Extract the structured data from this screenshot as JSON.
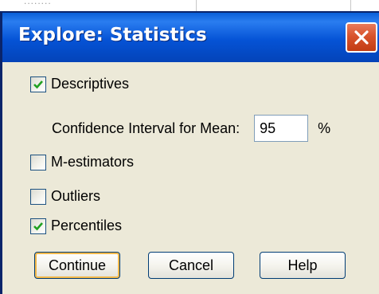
{
  "background": {
    "remnant_text": "........"
  },
  "dialog": {
    "title": "Explore: Statistics",
    "close_icon": "close-x-icon",
    "options": [
      {
        "label": "Descriptives",
        "checked": true
      },
      {
        "label": "M-estimators",
        "checked": false
      },
      {
        "label": "Outliers",
        "checked": false
      },
      {
        "label": "Percentiles",
        "checked": true
      }
    ],
    "confidence_interval": {
      "label": "Confidence Interval for Mean:",
      "value": "95",
      "unit": "%"
    },
    "buttons": {
      "continue": "Continue",
      "cancel": "Cancel",
      "help": "Help"
    }
  },
  "colors": {
    "title_bar": "#0553d6",
    "dialog_face": "#ece9d8",
    "check_mark": "#21a121",
    "close_button": "#d8532c"
  }
}
